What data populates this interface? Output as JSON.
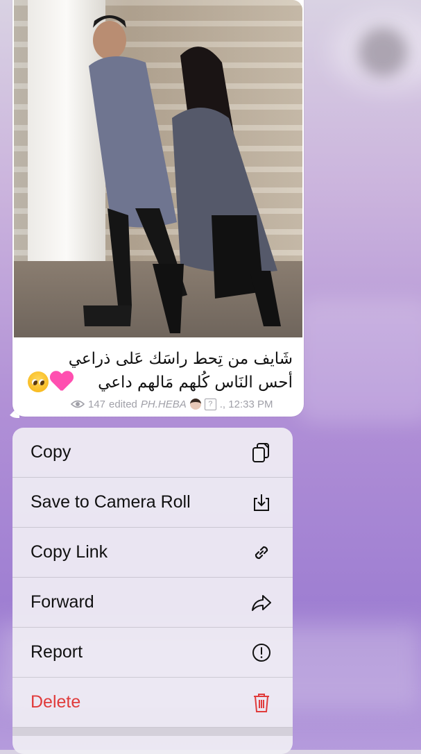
{
  "message": {
    "caption_line1": "شَايف من تِحط راسَك عَلى ذراعي",
    "caption_line2": "أحس النَاس كُلهم مَالهم داعي",
    "views": "147",
    "edited_label": "edited",
    "author": "PH.HEBA",
    "time": "., 12:33 PM",
    "qbox": "?",
    "emojis": [
      "heart-pink",
      "pleading-face"
    ]
  },
  "context_menu": {
    "items": [
      {
        "label": "Copy",
        "icon": "copy-icon"
      },
      {
        "label": "Save to Camera Roll",
        "icon": "save-icon"
      },
      {
        "label": "Copy Link",
        "icon": "link-icon"
      },
      {
        "label": "Forward",
        "icon": "forward-icon"
      },
      {
        "label": "Report",
        "icon": "report-icon"
      },
      {
        "label": "Delete",
        "icon": "trash-icon",
        "destructive": true
      }
    ]
  },
  "colors": {
    "destructive": "#e03b3b",
    "meta_text": "#a0a0a8",
    "background_accent": "#9f7fd2"
  }
}
